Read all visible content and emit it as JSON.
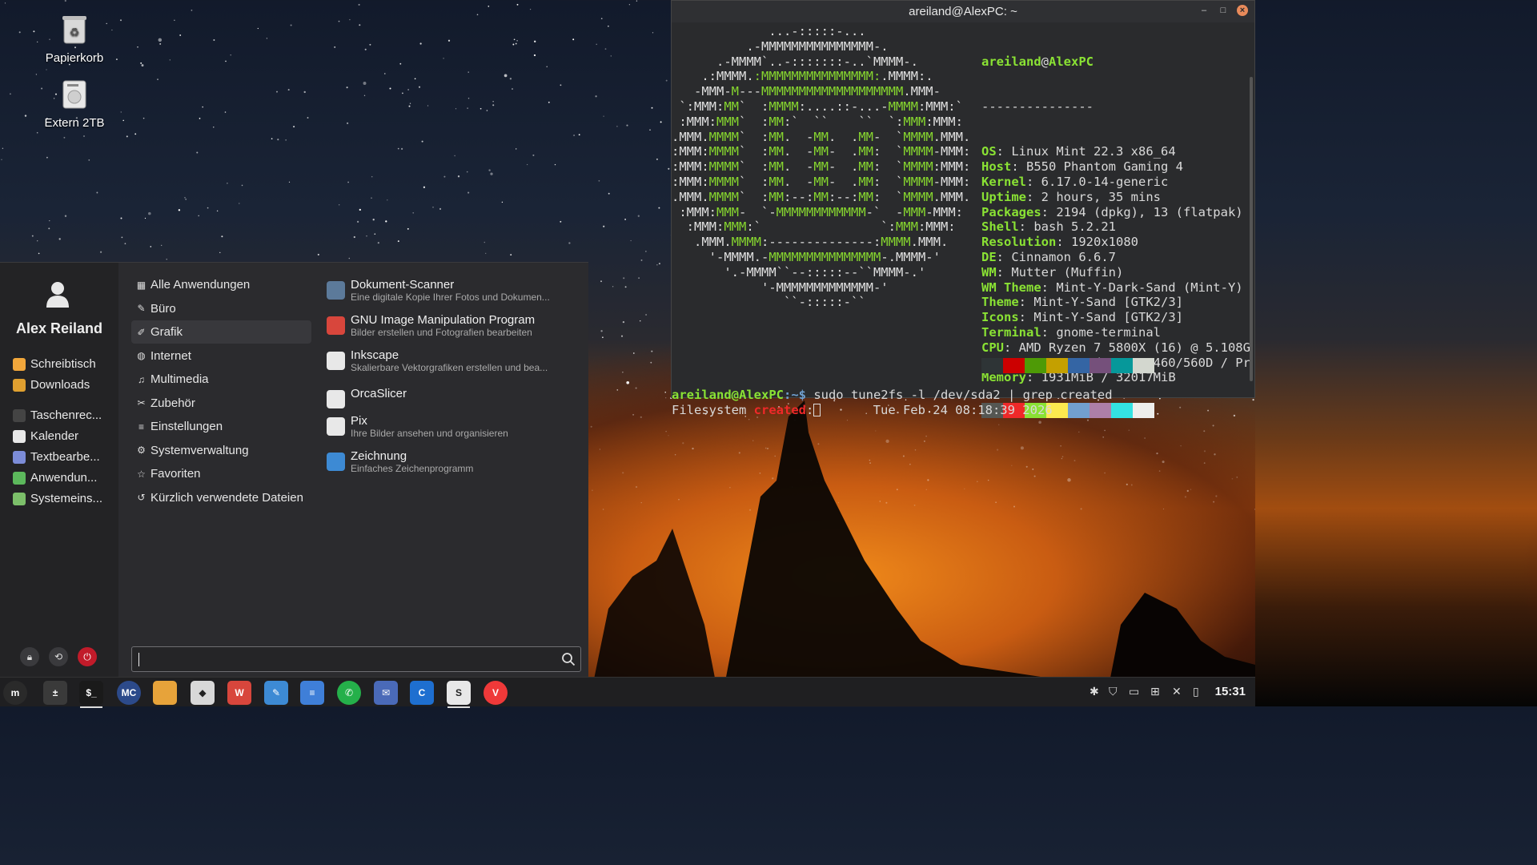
{
  "desktop": {
    "icons": [
      {
        "label": "Papierkorb",
        "icon": "trash-icon"
      },
      {
        "label": "Extern 2TB",
        "icon": "drive-icon"
      }
    ]
  },
  "terminal": {
    "title": "areiland@AlexPC: ~",
    "controls": {
      "minimize": "–",
      "maximize": "□",
      "close": "×"
    },
    "fetch": {
      "user": "areiland",
      "at": "@",
      "host": "AlexPC",
      "separator": "---------------",
      "rows": [
        {
          "key": "OS",
          "value": " Linux Mint 22.3 x86_64"
        },
        {
          "key": "Host",
          "value": " B550 Phantom Gaming 4"
        },
        {
          "key": "Kernel",
          "value": " 6.17.0-14-generic"
        },
        {
          "key": "Uptime",
          "value": " 2 hours, 35 mins"
        },
        {
          "key": "Packages",
          "value": " 2194 (dpkg), 13 (flatpak)"
        },
        {
          "key": "Shell",
          "value": " bash 5.2.21"
        },
        {
          "key": "Resolution",
          "value": " 1920x1080"
        },
        {
          "key": "DE",
          "value": " Cinnamon 6.6.7"
        },
        {
          "key": "WM",
          "value": " Mutter (Muffin)"
        },
        {
          "key": "WM Theme",
          "value": " Mint-Y-Dark-Sand (Mint-Y)"
        },
        {
          "key": "Theme",
          "value": " Mint-Y-Sand [GTK2/3]"
        },
        {
          "key": "Icons",
          "value": " Mint-Y-Sand [GTK2/3]"
        },
        {
          "key": "Terminal",
          "value": " gnome-terminal"
        },
        {
          "key": "CPU",
          "value": " AMD Ryzen 7 5800X (16) @ 5.108G"
        },
        {
          "key": "GPU",
          "value": " AMD ATI Radeon RX 460/560D / Pr"
        },
        {
          "key": "Memory",
          "value": " 1931MiB / 32017MiB"
        }
      ],
      "palette_top": [
        "#2e3436",
        "#cc0000",
        "#4e9a06",
        "#c4a000",
        "#3465a4",
        "#75507b",
        "#06989a",
        "#d3d7cf"
      ],
      "palette_bottom": [
        "#555753",
        "#ef2929",
        "#8ae234",
        "#fce94f",
        "#729fcf",
        "#ad7fa8",
        "#34e2e2",
        "#eeeeec"
      ]
    },
    "prompt": {
      "user_host": "areiland@AlexPC",
      "path": ":~$",
      "command": " sudo tune2fs -l /dev/sda2 | grep created"
    },
    "output": {
      "prefix": "Filesystem ",
      "highlight": "created",
      "suffix": ":",
      "value": "       Tue Feb 24 08:18:39 2026"
    }
  },
  "menu": {
    "user_name": "Alex Reiland",
    "favorites": [
      {
        "label": "Schreibtisch",
        "color": "#f2a73b"
      },
      {
        "label": "Downloads",
        "color": "#e0a030"
      },
      {
        "label": "Taschenrec...",
        "color": "#444"
      },
      {
        "label": "Kalender",
        "color": "#e8e8e8"
      },
      {
        "label": "Textbearbe...",
        "color": "#7c8cd8"
      },
      {
        "label": "Anwendun...",
        "color": "#5cb85c"
      },
      {
        "label": "Systemeins...",
        "color": "#7cbf6a"
      }
    ],
    "categories": [
      {
        "label": "Alle Anwendungen",
        "glyph": "▦"
      },
      {
        "label": "Büro",
        "glyph": "✎"
      },
      {
        "label": "Grafik",
        "glyph": "✐"
      },
      {
        "label": "Internet",
        "glyph": "◍"
      },
      {
        "label": "Multimedia",
        "glyph": "♫"
      },
      {
        "label": "Zubehör",
        "glyph": "✂"
      },
      {
        "label": "Einstellungen",
        "glyph": "≡"
      },
      {
        "label": "Systemverwaltung",
        "glyph": "⚙"
      },
      {
        "label": "Favoriten",
        "glyph": "☆"
      },
      {
        "label": "Kürzlich verwendete Dateien",
        "glyph": "↺"
      }
    ],
    "selected_category": "Grafik",
    "apps": [
      {
        "name": "Dokument-Scanner",
        "desc": "Eine digitale Kopie Ihrer Fotos und Dokumen...",
        "color": "#5c7a9a"
      },
      {
        "name": "GNU Image Manipulation Program",
        "desc": "Bilder erstellen und Fotografien bearbeiten",
        "color": "#d8463c"
      },
      {
        "name": "Inkscape",
        "desc": "Skalierbare Vektorgrafiken erstellen und bea...",
        "color": "#e8e8e8"
      },
      {
        "name": "OrcaSlicer",
        "desc": "",
        "color": "#e8e8e8"
      },
      {
        "name": "Pix",
        "desc": "Ihre Bilder ansehen und organisieren",
        "color": "#e8e8e8"
      },
      {
        "name": "Zeichnung",
        "desc": "Einfaches Zeichenprogramm",
        "color": "#3d8ad4"
      }
    ],
    "search": {
      "value": "",
      "placeholder": ""
    }
  },
  "panel": {
    "launchers": [
      {
        "name": "mint-menu",
        "color": "#2a2a2a",
        "glyph": "m"
      },
      {
        "name": "calculator",
        "color": "#3a3a3a",
        "glyph": "±"
      },
      {
        "name": "terminal",
        "color": "#1a1a1a",
        "glyph": "$_"
      },
      {
        "name": "multicommander",
        "color": "#2c4a8a",
        "glyph": "MC"
      },
      {
        "name": "files",
        "color": "#e7a33a",
        "glyph": ""
      },
      {
        "name": "inkscape",
        "color": "#d8d8d8",
        "glyph": "◆"
      },
      {
        "name": "gimp",
        "color": "#d8463c",
        "glyph": "W"
      },
      {
        "name": "drawing",
        "color": "#3d8ad4",
        "glyph": "✎"
      },
      {
        "name": "text-editor",
        "color": "#3f7fd8",
        "glyph": "≡"
      },
      {
        "name": "whatsapp",
        "color": "#25b04a",
        "glyph": "✆"
      },
      {
        "name": "mail",
        "color": "#4a6ab8",
        "glyph": "✉"
      },
      {
        "name": "codeblocks",
        "color": "#1e6fd0",
        "glyph": "C"
      },
      {
        "name": "orcaslicer",
        "color": "#e8e8e8",
        "glyph": "S"
      },
      {
        "name": "vivaldi",
        "color": "#ef3939",
        "glyph": "V"
      }
    ],
    "clock": "15:31"
  }
}
